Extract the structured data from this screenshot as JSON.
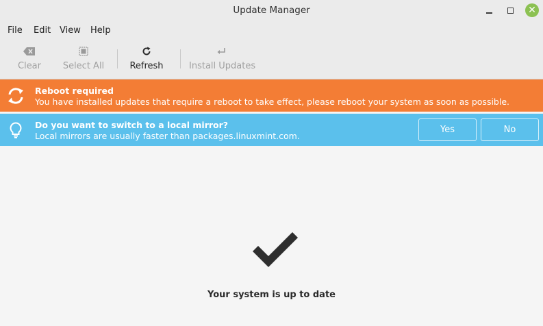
{
  "window": {
    "title": "Update Manager"
  },
  "menu": {
    "items": [
      "File",
      "Edit",
      "View",
      "Help"
    ]
  },
  "toolbar": {
    "clear_label": "Clear",
    "select_all_label": "Select All",
    "refresh_label": "Refresh",
    "install_label": "Install Updates"
  },
  "reboot_bar": {
    "title": "Reboot required",
    "message": "You have installed updates that require a reboot to take effect, please reboot your system as soon as possible.",
    "color": "#f37d35"
  },
  "mirror_bar": {
    "title": "Do you want to switch to a local mirror?",
    "message": "Local mirrors are usually faster than packages.linuxmint.com.",
    "yes_label": "Yes",
    "no_label": "No",
    "color": "#5bc0ec"
  },
  "main": {
    "status_text": "Your system is up to date"
  },
  "icons": {
    "clear": "backspace-icon",
    "select_all": "select-all-icon",
    "refresh": "refresh-icon",
    "install": "enter-icon",
    "reboot": "sync-icon",
    "mirror": "lightbulb-icon",
    "status": "checkmark-icon"
  }
}
